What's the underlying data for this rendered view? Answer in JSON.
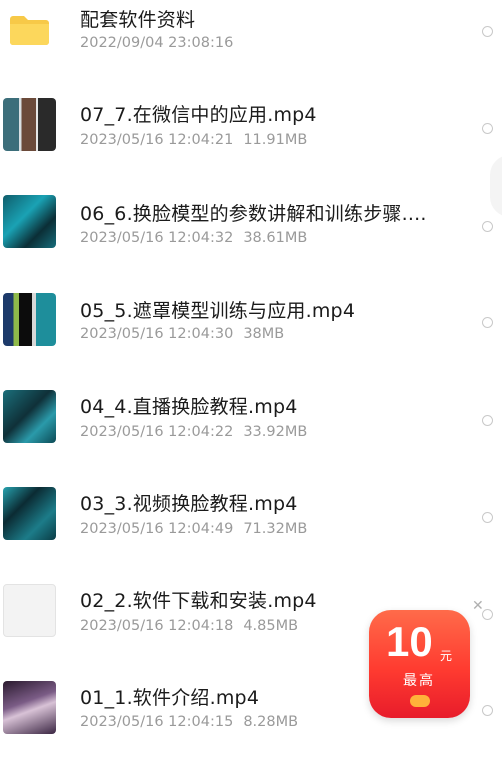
{
  "files": [
    {
      "name": "配套软件资料",
      "date": "2022/09/04 23:08:16",
      "size": "",
      "icon": "folder-icon",
      "thumb": "t-folder"
    },
    {
      "name": "07_7.在微信中的应用.mp4",
      "date": "2023/05/16 12:04:21",
      "size": "11.91MB",
      "icon": "video-thumbnail",
      "thumb": "t-a"
    },
    {
      "name": "06_6.换脸模型的参数讲解和训练步骤....",
      "date": "2023/05/16 12:04:32",
      "size": "38.61MB",
      "icon": "video-thumbnail",
      "thumb": "t-b"
    },
    {
      "name": "05_5.遮罩模型训练与应用.mp4",
      "date": "2023/05/16 12:04:30",
      "size": "38MB",
      "icon": "video-thumbnail",
      "thumb": "t-c"
    },
    {
      "name": "04_4.直播换脸教程.mp4",
      "date": "2023/05/16 12:04:22",
      "size": "33.92MB",
      "icon": "video-thumbnail",
      "thumb": "t-d"
    },
    {
      "name": "03_3.视频换脸教程.mp4",
      "date": "2023/05/16 12:04:49",
      "size": "71.32MB",
      "icon": "video-thumbnail",
      "thumb": "t-e"
    },
    {
      "name": "02_2.软件下载和安装.mp4",
      "date": "2023/05/16 12:04:18",
      "size": "4.85MB",
      "icon": "video-thumbnail",
      "thumb": "t-f"
    },
    {
      "name": "01_1.软件介绍.mp4",
      "date": "2023/05/16 12:04:15",
      "size": "8.28MB",
      "icon": "video-thumbnail",
      "thumb": "t-g"
    }
  ],
  "promo": {
    "amount": "10",
    "unit": "元",
    "label": "最高"
  },
  "colors": {
    "accent": "#ff3b30",
    "folder": "#f7c948",
    "meta": "#9a9a9a"
  }
}
